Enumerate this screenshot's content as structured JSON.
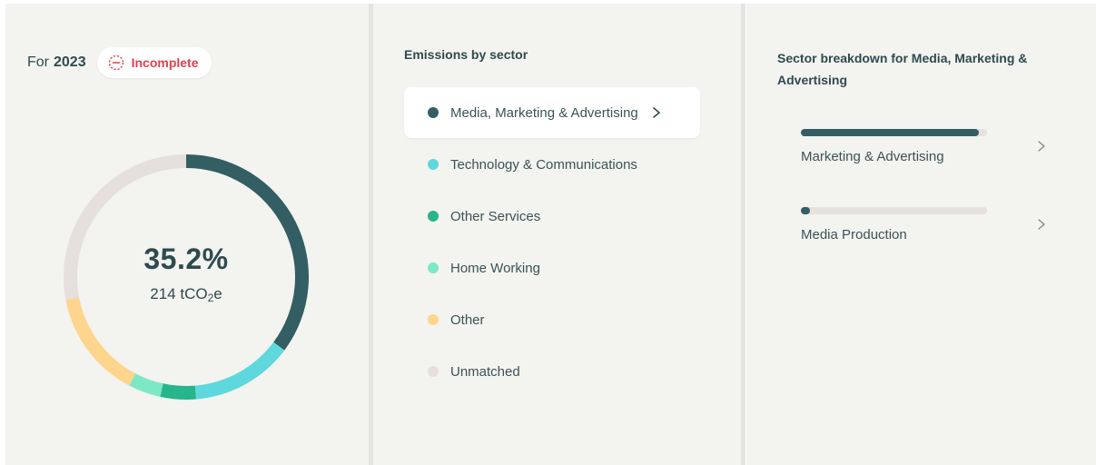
{
  "header": {
    "year_prefix": "For",
    "year": "2023",
    "status": {
      "label": "Incomplete",
      "icon": "dashed-circle-minus-icon",
      "color": "#e0414f"
    }
  },
  "summary": {
    "percentage": "35.2%",
    "amount": "214 tCO",
    "amount_sub": "2",
    "amount_suffix": "e"
  },
  "chart_data": {
    "type": "pie",
    "categories": [
      "Media, Marketing & Advertising",
      "Technology & Communications",
      "Other Services",
      "Home Working",
      "Other",
      "Unmatched"
    ],
    "values": [
      35.2,
      13.5,
      4.7,
      4.3,
      14.3,
      28.0
    ],
    "colors": [
      "#335e63",
      "#5ed8dc",
      "#27b58b",
      "#7de8c6",
      "#fdd58c",
      "#e5e0dd"
    ]
  },
  "sectors": {
    "title": "Emissions by sector",
    "items": [
      {
        "label": "Media, Marketing & Advertising",
        "color": "#335e63",
        "active": true
      },
      {
        "label": "Technology & Communications",
        "color": "#5ed8dc"
      },
      {
        "label": "Other Services",
        "color": "#27b58b"
      },
      {
        "label": "Home Working",
        "color": "#7de8c6"
      },
      {
        "label": "Other",
        "color": "#fdd58c"
      },
      {
        "label": "Unmatched",
        "color": "#e5e0dd"
      }
    ]
  },
  "breakdown": {
    "title": "Sector breakdown for Media, Marketing & Advertising",
    "items": [
      {
        "label": "Marketing & Advertising",
        "share": 0.955
      },
      {
        "label": "Media Production",
        "share": 0.045
      }
    ]
  },
  "colors": {
    "bar_fill": "#335e63",
    "bar_track": "#e6e1dd",
    "panel_bg": "#f3f3ef"
  }
}
